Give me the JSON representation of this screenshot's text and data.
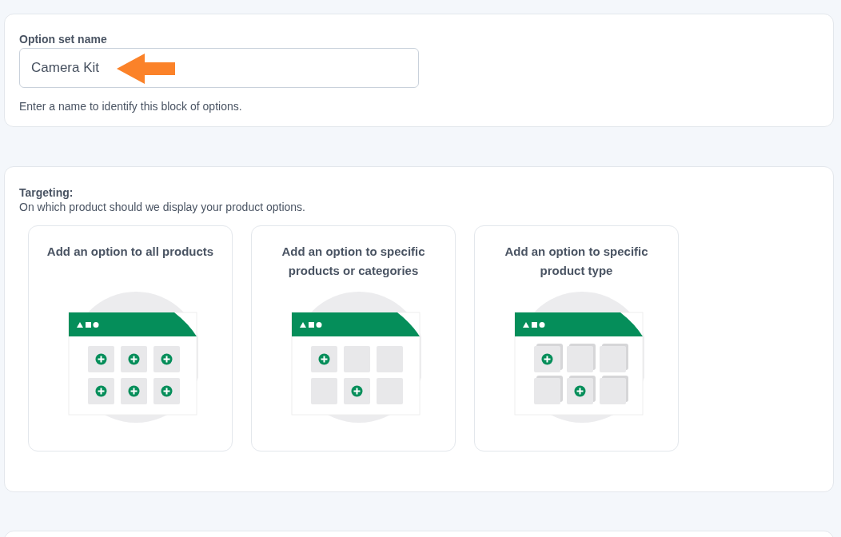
{
  "name_section": {
    "label": "Option set name",
    "value": "Camera Kit",
    "help": "Enter a name to identify this block of options."
  },
  "targeting": {
    "title": "Targeting:",
    "subtitle": "On which product should we display your product options.",
    "options": [
      {
        "title": "Add an option to all products",
        "kind": "all"
      },
      {
        "title": "Add an option to specific products or categories",
        "kind": "specific"
      },
      {
        "title": "Add an option to specific product type",
        "kind": "type"
      }
    ]
  }
}
